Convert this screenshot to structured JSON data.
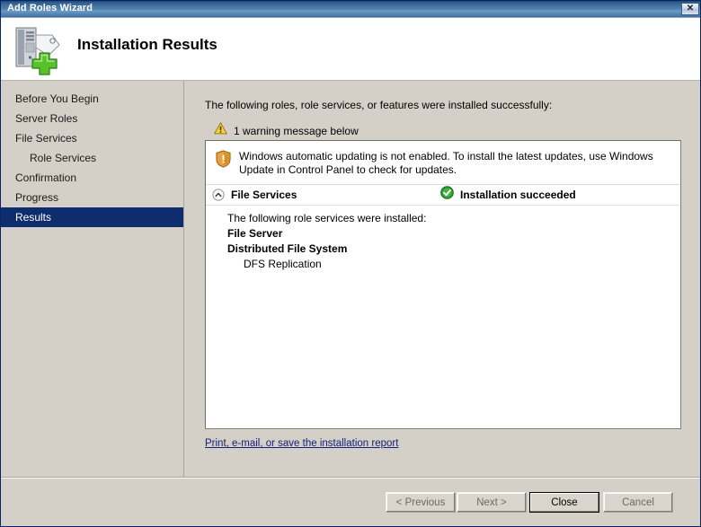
{
  "window": {
    "title": "Add Roles Wizard",
    "close_label": "✕"
  },
  "header": {
    "title": "Installation Results",
    "icon": "server-add-icon"
  },
  "sidebar": {
    "items": [
      {
        "label": "Before You Begin",
        "sub": false,
        "selected": false
      },
      {
        "label": "Server Roles",
        "sub": false,
        "selected": false
      },
      {
        "label": "File Services",
        "sub": false,
        "selected": false
      },
      {
        "label": "Role Services",
        "sub": true,
        "selected": false
      },
      {
        "label": "Confirmation",
        "sub": false,
        "selected": false
      },
      {
        "label": "Progress",
        "sub": false,
        "selected": false
      },
      {
        "label": "Results",
        "sub": false,
        "selected": true
      }
    ]
  },
  "main": {
    "intro": "The following roles, role services, or features were installed successfully:",
    "warning_summary": "1 warning message below",
    "warning_icon": "warning-triangle-icon",
    "notice": {
      "icon": "shield-warning-icon",
      "text": "Windows automatic updating is not enabled. To install the latest updates, use Windows Update in Control Panel to check for updates."
    },
    "group": {
      "collapse_icon": "chevron-up-circle-icon",
      "title": "File Services",
      "status_icon": "success-check-icon",
      "status": "Installation succeeded",
      "lines": [
        {
          "text": "The following role services were installed:",
          "bold": false,
          "indent": false
        },
        {
          "text": "File Server",
          "bold": true,
          "indent": false
        },
        {
          "text": "Distributed File System",
          "bold": true,
          "indent": false
        },
        {
          "text": "DFS Replication",
          "bold": false,
          "indent": true
        }
      ]
    },
    "report_link": "Print, e-mail, or save the installation report"
  },
  "footer": {
    "buttons": [
      {
        "id": "btn-previous",
        "label": "< Previous",
        "enabled": false,
        "default": false
      },
      {
        "id": "btn-next",
        "label": "Next >",
        "enabled": false,
        "default": false
      },
      {
        "id": "btn-close",
        "label": "Close",
        "enabled": true,
        "default": true
      },
      {
        "id": "btn-cancel",
        "label": "Cancel",
        "enabled": false,
        "default": false
      }
    ]
  },
  "colors": {
    "titlebar_blue": "#41719c",
    "selection_navy": "#0e2d6e",
    "chrome_gray": "#d4d0c8",
    "link_blue": "#14207d",
    "success_green": "#2e9b2e",
    "warning_amber": "#e8a33d"
  }
}
